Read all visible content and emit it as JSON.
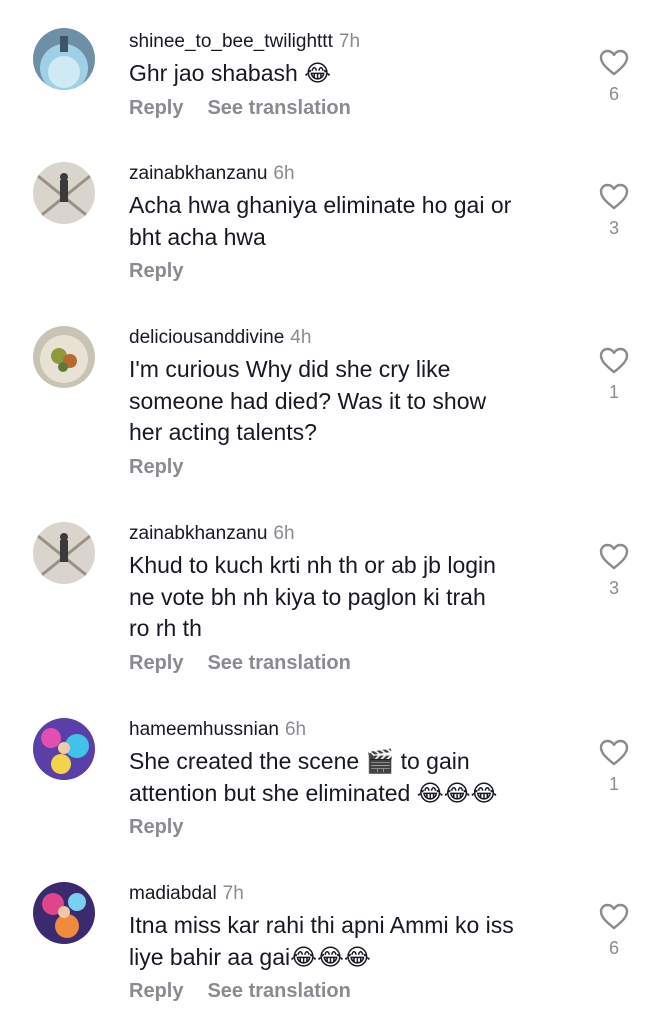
{
  "comments": [
    {
      "username": "shinee_to_bee_twilighttt",
      "time": "7h",
      "text": "Ghr jao shabash 😂",
      "reply": "Reply",
      "translation": "See translation",
      "likes": "6",
      "avatar": "blue-dress-photo"
    },
    {
      "username": "zainabkhanzanu",
      "time": "6h",
      "text": "Acha hwa ghaniya eliminate ho gai or\nbht acha hwa",
      "reply": "Reply",
      "translation": "",
      "likes": "3",
      "avatar": "bridge-person-photo"
    },
    {
      "username": "deliciousanddivine",
      "time": "4h",
      "text": "I'm curious Why did she cry like\nsomeone had died? Was it to show\nher acting talents?",
      "reply": "Reply",
      "translation": "",
      "likes": "1",
      "avatar": "food-plate-photo"
    },
    {
      "username": "zainabkhanzanu",
      "time": "6h",
      "text": "Khud to kuch krti nh th or ab jb login\nne vote bh nh kiya to paglon ki trah\nro rh th",
      "reply": "Reply",
      "translation": "See translation",
      "likes": "3",
      "avatar": "bridge-person-photo"
    },
    {
      "username": "hameemhussnian",
      "time": "6h",
      "text": "She created the scene 🎬 to gain\nattention but she eliminated 😂😂😂",
      "reply": "Reply",
      "translation": "",
      "likes": "1",
      "avatar": "colorful-party-photo"
    },
    {
      "username": "madiabdal",
      "time": "7h",
      "text": "Itna miss kar rahi thi apni Ammi ko iss\nliye bahir aa gai😂😂😂",
      "reply": "Reply",
      "translation": "See translation",
      "likes": "6",
      "avatar": "neon-party-photo"
    }
  ],
  "colors": {
    "text": "#161823",
    "secondary": "#8a8b91",
    "background": "#ffffff"
  },
  "icons": {
    "like": "heart-outline-icon"
  }
}
